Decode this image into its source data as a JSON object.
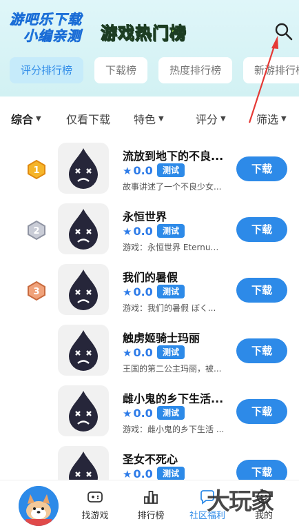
{
  "header": {
    "logo_line1": "游吧乐下载",
    "logo_line2": "小编亲测",
    "title": "游戏热门榜"
  },
  "tabs": [
    {
      "label": "评分排行榜",
      "active": true
    },
    {
      "label": "下载榜",
      "active": false
    },
    {
      "label": "热度排行榜",
      "active": false
    },
    {
      "label": "新游排行榜",
      "active": false
    }
  ],
  "filters": {
    "comprehensive": "综合",
    "download_only": "仅看下载",
    "feature": "特色",
    "score": "评分",
    "screen": "筛选"
  },
  "games": [
    {
      "name": "流放到地下的不良...",
      "rating": "0.0",
      "badge": "测试",
      "desc": "故事讲述了一个不良少女...",
      "button": "下载",
      "medal": "gold"
    },
    {
      "name": "永恒世界",
      "rating": "0.0",
      "badge": "测试",
      "desc": "游戏：永恒世界 Eternum ...",
      "button": "下载",
      "medal": "silver"
    },
    {
      "name": "我们的暑假",
      "rating": "0.0",
      "badge": "测试",
      "desc": "游戏：我们的暑假  ぼく...",
      "button": "下载",
      "medal": "bronze"
    },
    {
      "name": "触虏姬骑士玛丽",
      "rating": "0.0",
      "badge": "测试",
      "desc": "王国的第二公主玛丽，被...",
      "button": "下载",
      "medal": ""
    },
    {
      "name": "雌小鬼的乡下生活...",
      "rating": "0.0",
      "badge": "测试",
      "desc": "游戏：雌小鬼的乡下生活 ...",
      "button": "下载",
      "medal": ""
    },
    {
      "name": "圣女不死心",
      "rating": "0.0",
      "badge": "测试",
      "desc": "",
      "button": "下载",
      "medal": ""
    }
  ],
  "nav": {
    "find": "找游戏",
    "rank": "排行榜",
    "community": "社区福利",
    "mine": "我的"
  },
  "watermark": "大玩家",
  "colors": {
    "accent": "#2d8ae8",
    "header_bg": "#d2f1f3",
    "annotation_arrow": "#e53935"
  },
  "icons": {
    "search": "search-icon",
    "gamepad": "gamepad-icon",
    "bars": "bar-chart-icon",
    "chat": "chat-bubble-icon",
    "face": "smile-icon"
  }
}
